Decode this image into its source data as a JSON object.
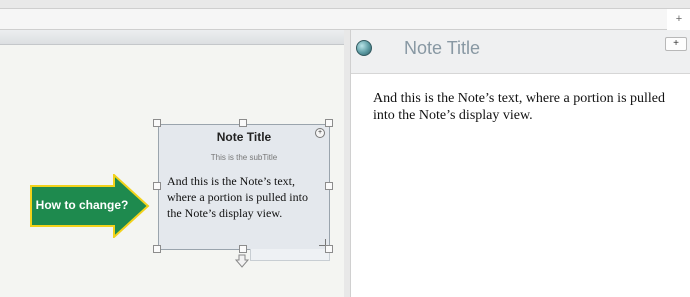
{
  "browser": {
    "new_tab_label": "+"
  },
  "callout": {
    "label": "How to change?",
    "fill_color": "#1e8a4e",
    "border_color": "#f2d21b"
  },
  "card": {
    "title": "Note Title",
    "expand_label": "+",
    "subtitle": "This is the subTitle",
    "text": "And this is the Note’s text, where a portion is pulled into the Note’s display view."
  },
  "note_panel": {
    "title": "Note Title",
    "plus_label": "+",
    "body": "And this is the Note’s text, where a portion is pulled into the Note’s display view."
  },
  "icons": [
    "status-orb-icon",
    "expand-icon",
    "resize-icon",
    "down-arrow-icon"
  ]
}
